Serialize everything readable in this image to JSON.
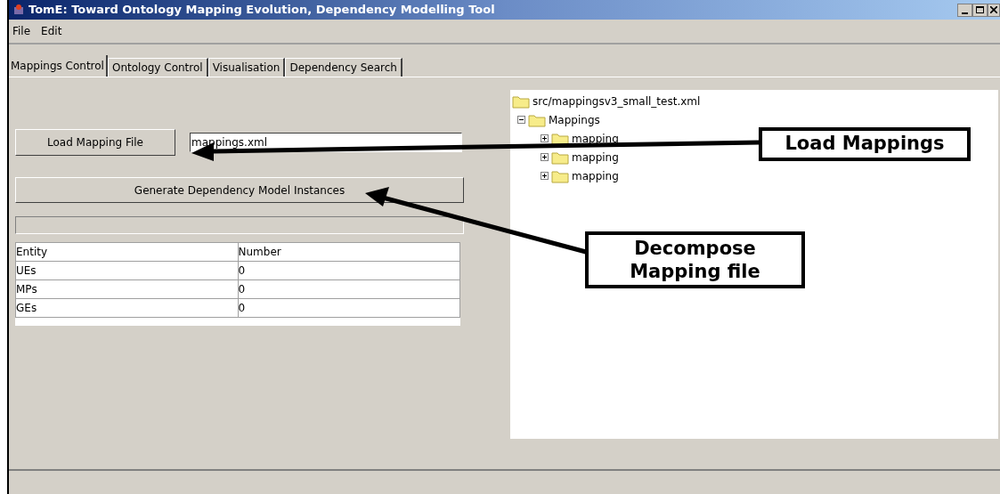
{
  "window": {
    "title": "TomE: Toward Ontology Mapping Evolution,  Dependency Modelling Tool"
  },
  "menu": [
    "File",
    "Edit"
  ],
  "tabs": [
    {
      "label": "Mappings Control",
      "selected": true
    },
    {
      "label": "Ontology Control",
      "selected": false
    },
    {
      "label": "Visualisation",
      "selected": false
    },
    {
      "label": "Dependency Search",
      "selected": false
    }
  ],
  "load_button": "Load Mapping File",
  "file_field": {
    "value": "mappings.xml"
  },
  "generate_button": "Generate Dependency Model Instances",
  "progress": {
    "level": 0
  },
  "table": {
    "columns": [
      "Entity",
      "Number"
    ],
    "rows": [
      [
        "UEs",
        "0"
      ],
      [
        "MPs",
        "0"
      ],
      [
        "GEs",
        "0"
      ]
    ]
  },
  "tree": {
    "label": "src/mappingsv3_small_test.xml",
    "children": [
      {
        "label": "Mappings",
        "expanded": true,
        "children": [
          {
            "label": "mapping",
            "expanded": false
          },
          {
            "label": "mapping",
            "expanded": false
          },
          {
            "label": "mapping",
            "expanded": false
          }
        ]
      }
    ]
  },
  "callouts": [
    {
      "text": "Load Mappings"
    },
    {
      "text": "Decompose Mapping file"
    }
  ]
}
